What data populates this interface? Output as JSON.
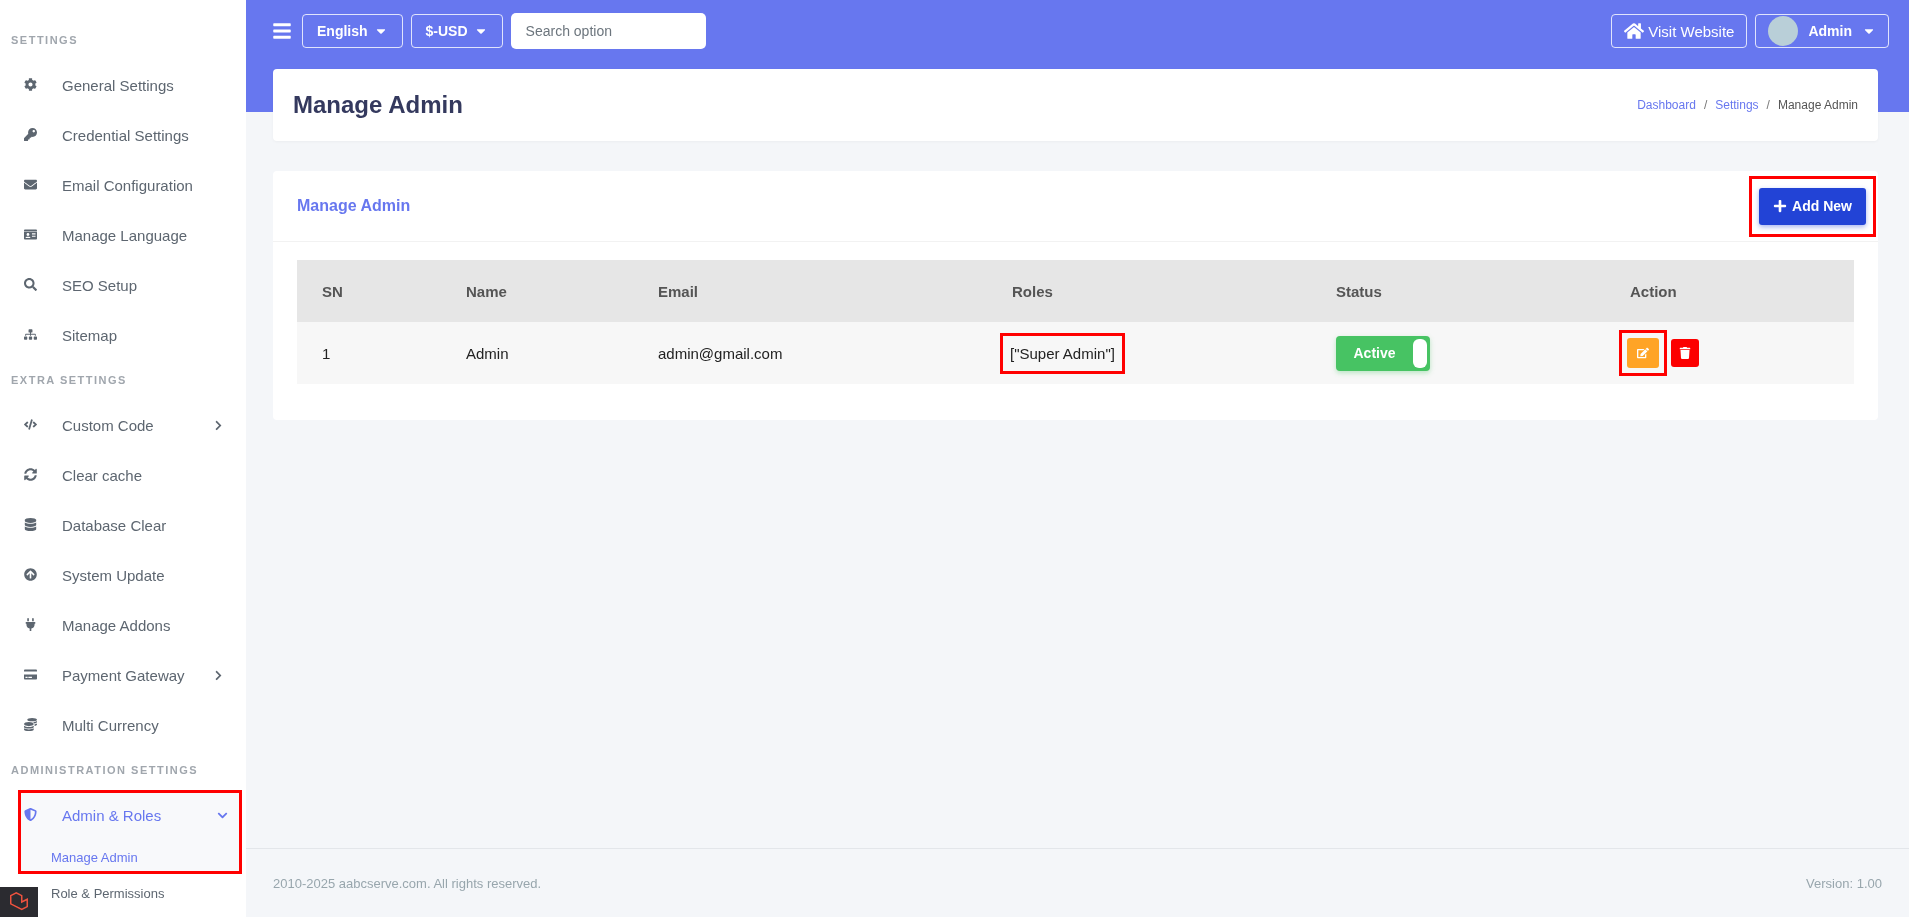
{
  "sidebar": {
    "sections": [
      {
        "title": "SETTINGS",
        "items": [
          {
            "label": "General Settings",
            "selected": false
          },
          {
            "label": "Credential Settings",
            "selected": false
          },
          {
            "label": "Email Configuration",
            "selected": false
          },
          {
            "label": "Manage Language",
            "selected": false
          },
          {
            "label": "SEO Setup",
            "selected": false
          },
          {
            "label": "Sitemap",
            "selected": false
          }
        ]
      },
      {
        "title": "EXTRA SETTINGS",
        "items": [
          {
            "label": "Custom Code",
            "selected": false,
            "expanded": false
          },
          {
            "label": "Clear cache",
            "selected": false
          },
          {
            "label": "Database Clear",
            "selected": false
          },
          {
            "label": "System Update",
            "selected": false
          },
          {
            "label": "Manage Addons",
            "selected": false
          },
          {
            "label": "Payment Gateway",
            "selected": false,
            "expanded": false
          },
          {
            "label": "Multi Currency",
            "selected": false
          }
        ]
      },
      {
        "title": "ADMINISTRATION SETTINGS",
        "items": [
          {
            "label": "Admin & Roles",
            "selected": true,
            "expanded": true,
            "highlighted": true,
            "children": [
              {
                "label": "Manage Admin",
                "selected": true
              },
              {
                "label": "Role & Permissions",
                "selected": false
              }
            ]
          }
        ]
      }
    ]
  },
  "topbar": {
    "language": "English",
    "currency": "$-USD",
    "search": {
      "placeholder": "Search option"
    },
    "visit_button": "Visit Website",
    "user": "Admin"
  },
  "page_header": {
    "title": "Manage Admin",
    "separator": "/",
    "breadcrumb": [
      {
        "label": "Dashboard",
        "link": true
      },
      {
        "label": "Settings",
        "link": true
      },
      {
        "label": "Manage Admin",
        "link": false
      }
    ]
  },
  "card": {
    "title": "Manage Admin",
    "add_button": {
      "label": "Add New",
      "highlighted": true
    },
    "table": {
      "columns": [
        "SN",
        "Name",
        "Email",
        "Roles",
        "Status",
        "Action"
      ],
      "rows": [
        {
          "sn": "1",
          "name": "Admin",
          "email": "admin@gmail.com",
          "roles": {
            "text": "[\"Super Admin\"]",
            "highlighted": true
          },
          "status": {
            "label": "Active",
            "on": true
          },
          "edit_highlighted": true
        }
      ]
    }
  },
  "footer": {
    "copyright": "2010-2025 aabcserve.com. All rights reserved.",
    "version": "Version: 1.00"
  }
}
